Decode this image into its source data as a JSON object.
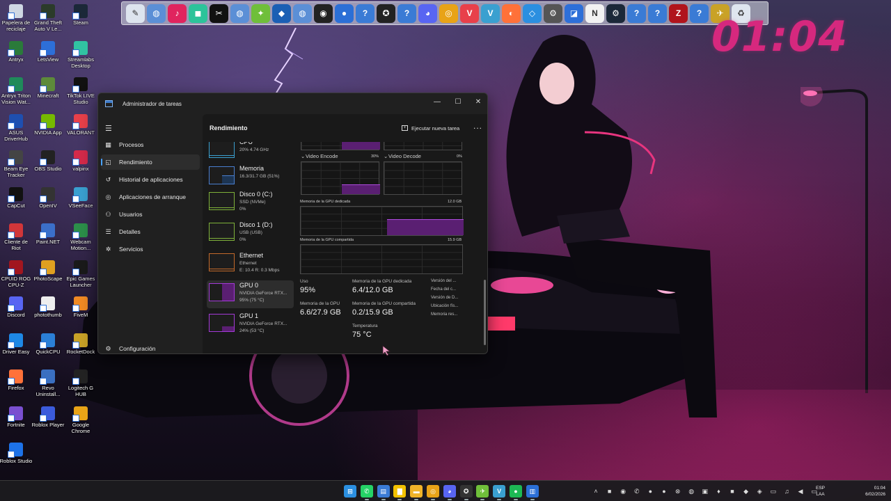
{
  "desktop": {
    "icons": [
      {
        "label": "Papelera de reciclaje",
        "icon": "recycle-bin-icon",
        "color": "#cfd8e3"
      },
      {
        "label": "Grand Theft Auto V Le...",
        "icon": "gta-icon",
        "color": "#2b3b2a"
      },
      {
        "label": "Steam",
        "icon": "steam-icon",
        "color": "#1b2838"
      },
      {
        "label": "Antryx",
        "icon": "antryx-icon",
        "color": "#2a7a3a"
      },
      {
        "label": "LetsView",
        "icon": "letsview-icon",
        "color": "#2d6fd8"
      },
      {
        "label": "Streamlabs Desktop",
        "icon": "streamlabs-icon",
        "color": "#31c3a2"
      },
      {
        "label": "Antryx Triton Vision Wat...",
        "icon": "antryx-triton-icon",
        "color": "#1f8a5a"
      },
      {
        "label": "Minecraft",
        "icon": "minecraft-icon",
        "color": "#5d8a3a"
      },
      {
        "label": "TikTok LIVE Studio",
        "icon": "tiktok-live-icon",
        "color": "#111111"
      },
      {
        "label": "ASUS DriverHub",
        "icon": "asus-icon",
        "color": "#1e4fb0"
      },
      {
        "label": "NVIDIA App",
        "icon": "nvidia-icon",
        "color": "#76b900"
      },
      {
        "label": "VALORANT",
        "icon": "valorant-icon",
        "color": "#e8404a"
      },
      {
        "label": "Beam Eye Tracker",
        "icon": "beam-eye-icon",
        "color": "#444444"
      },
      {
        "label": "OBS Studio",
        "icon": "obs-icon",
        "color": "#222222"
      },
      {
        "label": "valpinx",
        "icon": "valpinx-icon",
        "color": "#d42a4a"
      },
      {
        "label": "CapCut",
        "icon": "capcut-icon",
        "color": "#111111"
      },
      {
        "label": "OpenIV",
        "icon": "openiv-icon",
        "color": "#333333"
      },
      {
        "label": "VSeeFace",
        "icon": "vseeface-icon",
        "color": "#3aa0d0"
      },
      {
        "label": "Cliente de Riot",
        "icon": "riot-icon",
        "color": "#d13639"
      },
      {
        "label": "Paint.NET",
        "icon": "paintnet-icon",
        "color": "#3b6fc9"
      },
      {
        "label": "Webcam Motion...",
        "icon": "webcam-icon",
        "color": "#2c8f4a"
      },
      {
        "label": "CPUID ROG CPU-Z",
        "icon": "cpuz-icon",
        "color": "#a1161f"
      },
      {
        "label": "PhotoScape",
        "icon": "photoscape-icon",
        "color": "#e0a020"
      },
      {
        "label": "Epic Games Launcher",
        "icon": "epic-icon",
        "color": "#1a1a1a"
      },
      {
        "label": "Discord",
        "icon": "discord-icon",
        "color": "#5865f2"
      },
      {
        "label": "photothumb",
        "icon": "photothumb-icon",
        "color": "#eeeeee"
      },
      {
        "label": "FiveM",
        "icon": "fivem-icon",
        "color": "#f08a24"
      },
      {
        "label": "Driver Easy",
        "icon": "drivereasy-icon",
        "color": "#1e88e5"
      },
      {
        "label": "QuickCPU",
        "icon": "quickcpu-icon",
        "color": "#2b7fd6"
      },
      {
        "label": "RocketDock",
        "icon": "rocketdock-icon",
        "color": "#c9a227"
      },
      {
        "label": "Firefox",
        "icon": "firefox-icon",
        "color": "#ff7139"
      },
      {
        "label": "Revo Uninstall...",
        "icon": "revo-icon",
        "color": "#3a6fc0"
      },
      {
        "label": "Logitech G HUB",
        "icon": "ghub-icon",
        "color": "#222222"
      },
      {
        "label": "Fortnite",
        "icon": "fortnite-icon",
        "color": "#7a4fd0"
      },
      {
        "label": "Roblox Player",
        "icon": "roblox-player-icon",
        "color": "#3b5bdb"
      },
      {
        "label": "Google Chrome",
        "icon": "chrome-icon",
        "color": "#e8a317"
      },
      {
        "label": "Roblox Studio",
        "icon": "roblox-studio-icon",
        "color": "#1d72e8"
      }
    ]
  },
  "dock": {
    "items": [
      {
        "icon": "notepad-icon",
        "glyph": "✎",
        "color": "#dde4ee"
      },
      {
        "icon": "globe-icon",
        "glyph": "◍",
        "color": "#5b8fd6"
      },
      {
        "icon": "tiktok-icon",
        "glyph": "♪",
        "color": "#e0245e"
      },
      {
        "icon": "gamepad-icon",
        "glyph": "◼",
        "color": "#2cc39a"
      },
      {
        "icon": "capcut-icon",
        "glyph": "✂",
        "color": "#111111"
      },
      {
        "icon": "globe-icon",
        "glyph": "◍",
        "color": "#5b8fd6"
      },
      {
        "icon": "alien-icon",
        "glyph": "✦",
        "color": "#6fbf3a"
      },
      {
        "icon": "cube-icon",
        "glyph": "◆",
        "color": "#1a5fb4"
      },
      {
        "icon": "globe-icon",
        "glyph": "◍",
        "color": "#5b8fd6"
      },
      {
        "icon": "obs-icon",
        "glyph": "◉",
        "color": "#222222"
      },
      {
        "icon": "drop-icon",
        "glyph": "●",
        "color": "#2b6fd6"
      },
      {
        "icon": "help-icon",
        "glyph": "?",
        "color": "#3a7bd5"
      },
      {
        "icon": "eagle-icon",
        "glyph": "✪",
        "color": "#222222"
      },
      {
        "icon": "help-icon",
        "glyph": "?",
        "color": "#3a7bd5"
      },
      {
        "icon": "discord-icon",
        "glyph": "◕",
        "color": "#5865f2"
      },
      {
        "icon": "chrome-icon",
        "glyph": "◎",
        "color": "#e8a317"
      },
      {
        "icon": "valorant-icon",
        "glyph": "V",
        "color": "#e8404a"
      },
      {
        "icon": "vseeface-icon",
        "glyph": "V",
        "color": "#3aa0d0"
      },
      {
        "icon": "firefox-icon",
        "glyph": "◐",
        "color": "#ff7139"
      },
      {
        "icon": "diamond-icon",
        "glyph": "◇",
        "color": "#2b8fe0"
      },
      {
        "icon": "cpuid-icon",
        "glyph": "⚙",
        "color": "#555555"
      },
      {
        "icon": "roblox-icon",
        "glyph": "◪",
        "color": "#2d6fd8"
      },
      {
        "icon": "notion-icon",
        "glyph": "N",
        "color": "#f2f2f2"
      },
      {
        "icon": "steam-icon",
        "glyph": "⚙",
        "color": "#1b2838"
      },
      {
        "icon": "help-icon",
        "glyph": "?",
        "color": "#3a7bd5"
      },
      {
        "icon": "help-icon",
        "glyph": "?",
        "color": "#3a7bd5"
      },
      {
        "icon": "rog-cpuz-icon",
        "glyph": "Z",
        "color": "#b0141c"
      },
      {
        "icon": "help-icon",
        "glyph": "?",
        "color": "#3a7bd5"
      },
      {
        "icon": "plane-icon",
        "glyph": "✈",
        "color": "#c9a227"
      },
      {
        "icon": "recycle-bin-icon",
        "glyph": "♻",
        "color": "#dfe6ef"
      }
    ]
  },
  "clock_widget": {
    "time": "01:04"
  },
  "task_manager": {
    "title": "Administrador de tareas",
    "nav": [
      {
        "label": "Procesos",
        "icon": "grid-icon",
        "glyph": "▦"
      },
      {
        "label": "Rendimiento",
        "icon": "performance-icon",
        "glyph": "◱",
        "active": true
      },
      {
        "label": "Historial de aplicaciones",
        "icon": "history-icon",
        "glyph": "↺"
      },
      {
        "label": "Aplicaciones de arranque",
        "icon": "startup-icon",
        "glyph": "◎"
      },
      {
        "label": "Usuarios",
        "icon": "users-icon",
        "glyph": "⚇"
      },
      {
        "label": "Detalles",
        "icon": "details-icon",
        "glyph": "☰"
      },
      {
        "label": "Servicios",
        "icon": "services-icon",
        "glyph": "✲"
      }
    ],
    "settings_label": "Configuración",
    "header": {
      "title": "Rendimiento",
      "run_task": "Ejecutar nueva tarea",
      "more": "..."
    },
    "devices": [
      {
        "name": "CPU",
        "sub1": "20%  4.74 GHz",
        "sub2": "",
        "color": "#3aa0d0"
      },
      {
        "name": "Memoria",
        "sub1": "16.3/31.7 GB (51%)",
        "sub2": "",
        "color": "#4a7fd0"
      },
      {
        "name": "Disco 0 (C:)",
        "sub1": "SSD (NVMe)",
        "sub2": "0%",
        "color": "#7fb23a"
      },
      {
        "name": "Disco 1 (D:)",
        "sub1": "USB (USB)",
        "sub2": "0%",
        "color": "#7fb23a"
      },
      {
        "name": "Ethernet",
        "sub1": "Ethernet",
        "sub2": "E: 10.4  R: 0.3 Mbps",
        "color": "#c46a2a"
      },
      {
        "name": "GPU 0",
        "sub1": "NVIDIA GeForce RTX...",
        "sub2": "95% (75 °C)",
        "color": "#a43ad8",
        "active": true
      },
      {
        "name": "GPU 1",
        "sub1": "NVIDIA GeForce RTX...",
        "sub2": "24% (53 °C)",
        "color": "#a43ad8"
      }
    ],
    "gpu_detail": {
      "video_encode_label": "Video Encode",
      "video_encode_pct": "30%",
      "video_decode_label": "Video Decode",
      "video_decode_pct": "0%",
      "dedicated_label": "Memoria de la GPU dedicada",
      "dedicated_max": "12.0 GB",
      "shared_label": "Memoria de la GPU compartida",
      "shared_max": "15.9 GB",
      "usage_label": "Uso",
      "usage_value": "95%",
      "dedicated_mem_label": "Memoria de la GPU dedicada",
      "dedicated_mem_value": "6.4/12.0 GB",
      "gpu_mem_label": "Memoria de la GPU",
      "gpu_mem_value": "6.6/27.9 GB",
      "shared_mem_label": "Memoria de la GPU compartida",
      "shared_mem_value": "0.2/15.9 GB",
      "temp_label": "Temperatura",
      "temp_value": "75 °C",
      "side_labels": [
        "Versión del ...",
        "Fecha del c...",
        "Versión de D...",
        "Ubicación fís...",
        "Memoria res..."
      ]
    }
  },
  "taskbar": {
    "apps": [
      {
        "icon": "windows-start-icon",
        "glyph": "⊞",
        "color": "#2b8fe0"
      },
      {
        "icon": "whatsapp-icon",
        "glyph": "✆",
        "color": "#25d366"
      },
      {
        "icon": "sticky-notes-icon",
        "glyph": "▤",
        "color": "#3a7bd5"
      },
      {
        "icon": "notes-icon",
        "glyph": "▇",
        "color": "#f2c200"
      },
      {
        "icon": "file-explorer-icon",
        "glyph": "▬",
        "color": "#f0b429"
      },
      {
        "icon": "chrome-icon",
        "glyph": "◎",
        "color": "#e8a317"
      },
      {
        "icon": "discord-icon",
        "glyph": "◕",
        "color": "#5865f2"
      },
      {
        "icon": "eagle-icon",
        "glyph": "✪",
        "color": "#333333"
      },
      {
        "icon": "bird-icon",
        "glyph": "✈",
        "color": "#6fbf3a"
      },
      {
        "icon": "vseeface-icon",
        "glyph": "V",
        "color": "#3aa0d0"
      },
      {
        "icon": "spotify-icon",
        "glyph": "●",
        "color": "#1db954"
      },
      {
        "icon": "task-manager-icon",
        "glyph": "▥",
        "color": "#2b6fd6"
      }
    ],
    "tray": [
      {
        "icon": "chevron-up-icon",
        "glyph": "˄"
      },
      {
        "icon": "nvidia-tray-icon",
        "glyph": "■"
      },
      {
        "icon": "steam-tray-icon",
        "glyph": "◉"
      },
      {
        "icon": "whatsapp-tray-icon",
        "glyph": "✆"
      },
      {
        "icon": "drop-tray-icon",
        "glyph": "●"
      },
      {
        "icon": "spotify-tray-icon",
        "glyph": "●"
      },
      {
        "icon": "xbox-tray-icon",
        "glyph": "⊗"
      },
      {
        "icon": "globe-tray-icon",
        "glyph": "◍"
      },
      {
        "icon": "app-tray-icon",
        "glyph": "▣"
      },
      {
        "icon": "mic-tray-icon",
        "glyph": "♦"
      },
      {
        "icon": "red-tray-icon",
        "glyph": "■"
      },
      {
        "icon": "game-tray-icon",
        "glyph": "◆"
      },
      {
        "icon": "shield-tray-icon",
        "glyph": "◈"
      },
      {
        "icon": "chat-tray-icon",
        "glyph": "▭"
      },
      {
        "icon": "microphone-icon",
        "glyph": "♫"
      },
      {
        "icon": "volume-icon",
        "glyph": "◀"
      },
      {
        "icon": "network-icon",
        "glyph": "▭"
      }
    ],
    "lang_top": "ESP",
    "lang_bottom": "LAA",
    "time": "01:04",
    "date": "6/02/2026"
  }
}
